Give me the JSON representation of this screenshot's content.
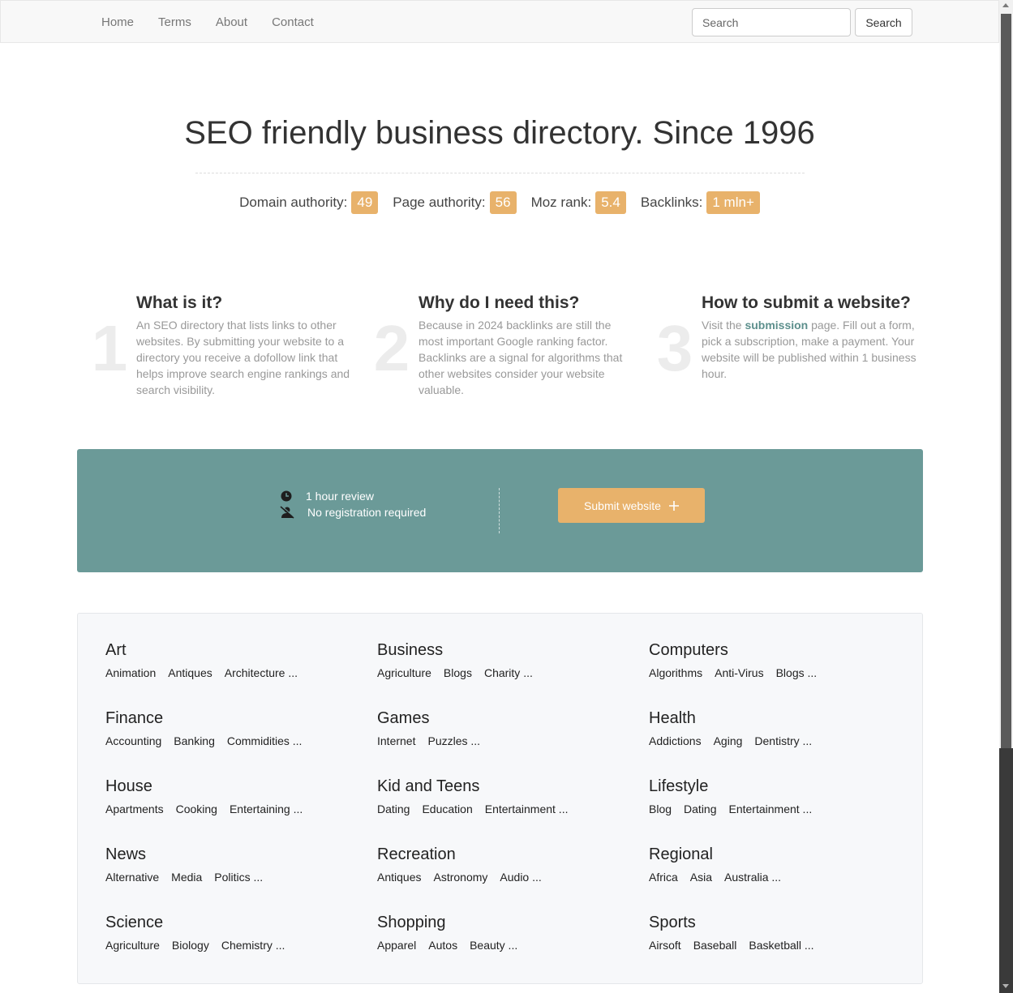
{
  "nav": {
    "links": [
      "Home",
      "Terms",
      "About",
      "Contact"
    ],
    "search_placeholder": "Search",
    "search_button": "Search"
  },
  "hero": {
    "title": "SEO friendly business directory. Since 1996",
    "stats": [
      {
        "label": "Domain authority:",
        "value": "49"
      },
      {
        "label": "Page authority:",
        "value": "56"
      },
      {
        "label": "Moz rank:",
        "value": "5.4"
      },
      {
        "label": "Backlinks:",
        "value": "1 mln+"
      }
    ]
  },
  "features": [
    {
      "num": "1",
      "title": "What is it?",
      "text": "An SEO directory that lists links to other websites. By submitting your website to a directory you receive a dofollow link that helps improve search engine rankings and search visibility."
    },
    {
      "num": "2",
      "title": "Why do I need this?",
      "text": "Because in 2024 backlinks are still the most important Google ranking factor. Backlinks are a signal for algorithms that other websites consider your website valuable."
    },
    {
      "num": "3",
      "title": "How to submit a website?",
      "text_before": "Visit the ",
      "link": "submission",
      "text_after": " page. Fill out a form, pick a subscription, make a payment. Your website will be published within 1 business hour."
    }
  ],
  "cta": {
    "review": "1 hour review",
    "registration": "No registration required",
    "button": "Submit website",
    "button_icon": "plus-icon",
    "color_bg": "#6b9a98",
    "color_accent": "#e8b26b"
  },
  "categories": [
    {
      "title": "Art",
      "subs": [
        "Animation",
        "Antiques",
        "Architecture ..."
      ]
    },
    {
      "title": "Business",
      "subs": [
        "Agriculture",
        "Blogs",
        "Charity ..."
      ]
    },
    {
      "title": "Computers",
      "subs": [
        "Algorithms",
        "Anti-Virus",
        "Blogs ..."
      ]
    },
    {
      "title": "Finance",
      "subs": [
        "Accounting",
        "Banking",
        "Commidities ..."
      ]
    },
    {
      "title": "Games",
      "subs": [
        "Internet",
        "Puzzles ..."
      ]
    },
    {
      "title": "Health",
      "subs": [
        "Addictions",
        "Aging",
        "Dentistry ..."
      ]
    },
    {
      "title": "House",
      "subs": [
        "Apartments",
        "Cooking",
        "Entertaining ..."
      ]
    },
    {
      "title": "Kid and Teens",
      "subs": [
        "Dating",
        "Education",
        "Entertainment ..."
      ]
    },
    {
      "title": "Lifestyle",
      "subs": [
        "Blog",
        "Dating",
        "Entertainment ..."
      ]
    },
    {
      "title": "News",
      "subs": [
        "Alternative",
        "Media",
        "Politics ..."
      ]
    },
    {
      "title": "Recreation",
      "subs": [
        "Antiques",
        "Astronomy",
        "Audio ..."
      ]
    },
    {
      "title": "Regional",
      "subs": [
        "Africa",
        "Asia",
        "Australia ..."
      ]
    },
    {
      "title": "Science",
      "subs": [
        "Agriculture",
        "Biology",
        "Chemistry ..."
      ]
    },
    {
      "title": "Shopping",
      "subs": [
        "Apparel",
        "Autos",
        "Beauty ..."
      ]
    },
    {
      "title": "Sports",
      "subs": [
        "Airsoft",
        "Baseball",
        "Basketball ..."
      ]
    }
  ]
}
